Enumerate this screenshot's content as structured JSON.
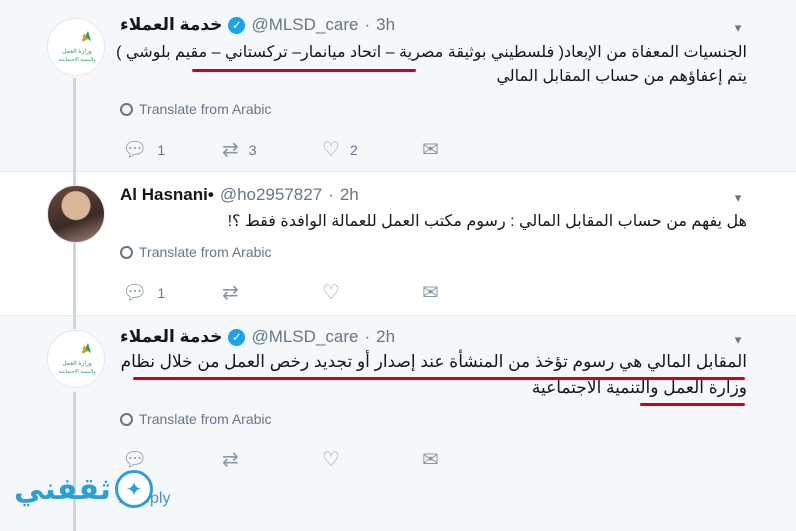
{
  "tweets": [
    {
      "name": "خدمة العملاء",
      "handle": "@MLSD_care",
      "dot": "·",
      "time": "3h",
      "avatar_lines": [
        "وزارة العمل",
        "والتنمية الاجتماعية"
      ],
      "text": "الجنسيات المعفاة من الإبعاد( فلسطيني بوثيقة مصرية – اتحاد ميانمار– تركستاني – مقيم بلوشي ) يتم إعفاؤهم من حساب المقابل المالي",
      "translate": "Translate from Arabic",
      "reply_count": "1",
      "retweet_count": "3",
      "like_count": "2"
    },
    {
      "name": "Al Hasnani•",
      "handle": "@ho2957827",
      "dot": "·",
      "time": "2h",
      "text": "هل يفهم من حساب المقابل المالي : رسوم مكتب العمل للعمالة الوافدة فقط ؟!",
      "translate": "Translate from Arabic",
      "reply_count": "1",
      "retweet_count": "",
      "like_count": ""
    },
    {
      "name": "خدمة العملاء",
      "handle": "@MLSD_care",
      "dot": "·",
      "time": "2h",
      "avatar_lines": [
        "وزارة العمل",
        "والتنمية الاجتماعية"
      ],
      "text": "المقابل المالي هي رسوم تؤخذ من المنشأة عند إصدار أو تجديد رخص العمل من خلال نظام وزارة العمل والتنمية الاجتماعية",
      "translate": "Translate from Arabic",
      "reply_count": "",
      "retweet_count": "",
      "like_count": ""
    }
  ],
  "watermark": {
    "text": "ثقفني",
    "partial": "1 r    oply"
  },
  "icons": {
    "reply": "reply-icon",
    "retweet": "retweet-icon",
    "like": "heart-icon",
    "dm": "envelope-icon",
    "caret": "chevron-down-icon",
    "verified": "verified-badge-icon",
    "globe": "globe-icon"
  },
  "colors": {
    "verified": "#1da1f2",
    "muted": "#657786",
    "underline": "#d0021b",
    "watermark": "#2aa0d6",
    "selected_bg": "#f5f8fa"
  }
}
